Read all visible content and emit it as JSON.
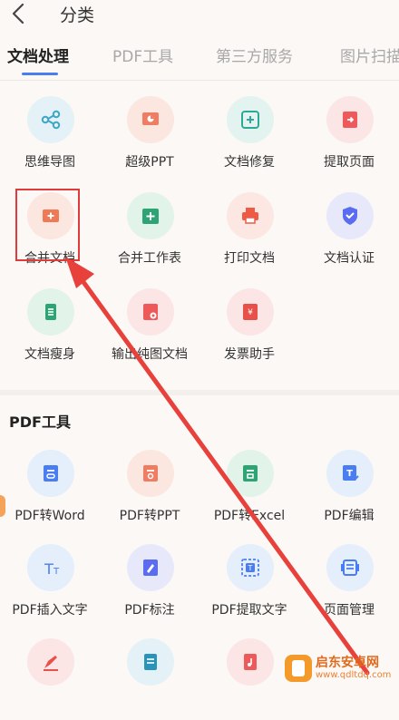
{
  "header": {
    "title": "分类"
  },
  "tabs": [
    {
      "label": "文档处理",
      "active": true
    },
    {
      "label": "PDF工具",
      "active": false
    },
    {
      "label": "第三方服务",
      "active": false
    },
    {
      "label": "图片扫描",
      "active": false
    }
  ],
  "doc_tools": [
    {
      "label": "思维导图",
      "icon": "mindmap-icon",
      "bg": "#e4f2f7",
      "fg": "#3fa6c4"
    },
    {
      "label": "超级PPT",
      "icon": "ppt-icon",
      "bg": "#fbe6e0",
      "fg": "#ef7d62"
    },
    {
      "label": "文档修复",
      "icon": "repair-icon",
      "bg": "#e2f3f0",
      "fg": "#2fa89a"
    },
    {
      "label": "提取页面",
      "icon": "extract-page-icon",
      "bg": "#fce5e5",
      "fg": "#ee5a5a"
    },
    {
      "label": "合并文档",
      "icon": "merge-doc-icon",
      "bg": "#fbe6e0",
      "fg": "#f07a55"
    },
    {
      "label": "合并工作表",
      "icon": "merge-sheet-icon",
      "bg": "#e2f3ea",
      "fg": "#2ea374"
    },
    {
      "label": "打印文档",
      "icon": "print-icon",
      "bg": "#fce7e3",
      "fg": "#ee5a46"
    },
    {
      "label": "文档认证",
      "icon": "certify-icon",
      "bg": "#e7e9fb",
      "fg": "#5a6cf0"
    },
    {
      "label": "文档瘦身",
      "icon": "slim-icon",
      "bg": "#e2f3ea",
      "fg": "#2ea374"
    },
    {
      "label": "输出纯图文档",
      "icon": "image-doc-icon",
      "bg": "#fce5e5",
      "fg": "#ee5a5a"
    },
    {
      "label": "发票助手",
      "icon": "invoice-icon",
      "bg": "#fce5e5",
      "fg": "#e8504a"
    }
  ],
  "pdf_section": {
    "title": "PDF工具"
  },
  "pdf_tools": [
    {
      "label": "PDF转Word",
      "icon": "pdf-to-word-icon",
      "bg": "#e5eefb",
      "fg": "#4a7ef0"
    },
    {
      "label": "PDF转PPT",
      "icon": "pdf-to-ppt-icon",
      "bg": "#fbe6e0",
      "fg": "#ef7d62"
    },
    {
      "label": "PDF转Excel",
      "icon": "pdf-to-excel-icon",
      "bg": "#e2f3ea",
      "fg": "#2ea374"
    },
    {
      "label": "PDF编辑",
      "icon": "pdf-edit-icon",
      "bg": "#e5eefb",
      "fg": "#4a7ef0"
    },
    {
      "label": "PDF插入文字",
      "icon": "insert-text-icon",
      "bg": "#e5eefb",
      "fg": "#4a7ef0"
    },
    {
      "label": "PDF标注",
      "icon": "annotate-icon",
      "bg": "#e7e9fb",
      "fg": "#5a6cf0"
    },
    {
      "label": "PDF提取文字",
      "icon": "extract-text-icon",
      "bg": "#e5eefb",
      "fg": "#4a7ef0"
    },
    {
      "label": "页面管理",
      "icon": "page-manage-icon",
      "bg": "#e5eefb",
      "fg": "#4a7ef0"
    },
    {
      "label": "",
      "icon": "pdf-sign-icon",
      "bg": "#fce5e5",
      "fg": "#e8504a"
    },
    {
      "label": "",
      "icon": "pdf-compress-icon",
      "bg": "#e4f2f7",
      "fg": "#2a94b8"
    },
    {
      "label": "",
      "icon": "pdf-audio-icon",
      "bg": "#fce5e5",
      "fg": "#ee5a5a"
    }
  ],
  "watermark": {
    "title": "启东安卓网",
    "url": "www.qdltdq.com"
  }
}
